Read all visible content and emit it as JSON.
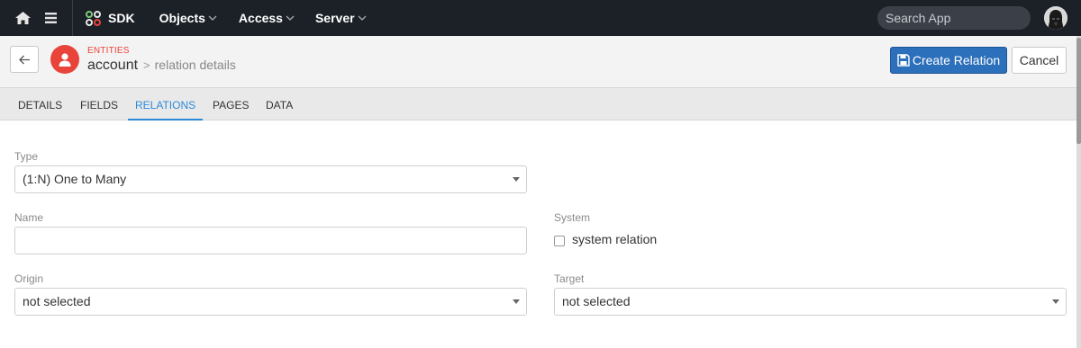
{
  "nav": {
    "brand_label": "SDK",
    "menus": [
      {
        "label": "Objects"
      },
      {
        "label": "Access"
      },
      {
        "label": "Server"
      }
    ],
    "search_placeholder": "Search App"
  },
  "header": {
    "eyebrow": "ENTITIES",
    "entity_name": "account",
    "breadcrumb_separator": ">",
    "page_subtitle": "relation details",
    "create_label": "Create Relation",
    "cancel_label": "Cancel"
  },
  "tabs": [
    {
      "label": "DETAILS"
    },
    {
      "label": "FIELDS"
    },
    {
      "label": "RELATIONS",
      "active": true
    },
    {
      "label": "PAGES"
    },
    {
      "label": "DATA"
    }
  ],
  "form": {
    "type": {
      "label": "Type",
      "value": "(1:N) One to Many"
    },
    "name": {
      "label": "Name",
      "value": ""
    },
    "system": {
      "label": "System",
      "checkbox_label": "system relation",
      "checked": false
    },
    "origin": {
      "label": "Origin",
      "value": "not selected"
    },
    "target": {
      "label": "Target",
      "value": "not selected"
    }
  },
  "colors": {
    "nav_bg": "#1c2027",
    "accent_red": "#e8443a",
    "primary_blue": "#2c6fbb",
    "tab_active": "#2c8ad8"
  }
}
